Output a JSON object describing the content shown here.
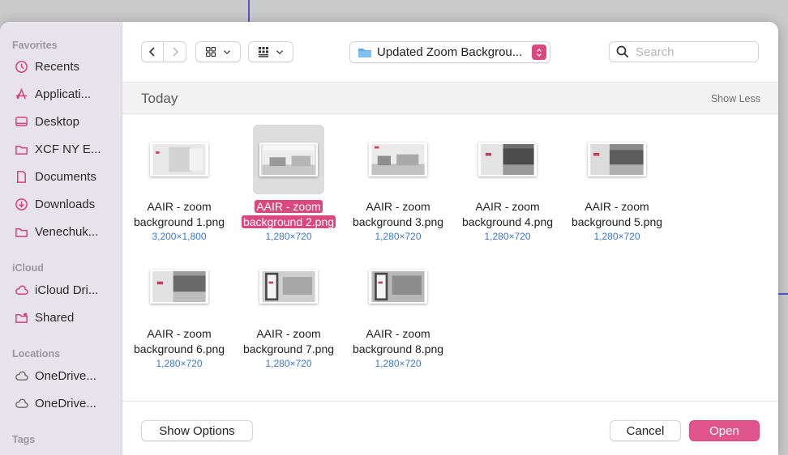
{
  "sidebar": {
    "sections": [
      {
        "label": "Favorites",
        "items": [
          {
            "label": "Recents",
            "icon": "clock-icon"
          },
          {
            "label": "Applicati...",
            "icon": "applications-icon"
          },
          {
            "label": "Desktop",
            "icon": "desktop-icon"
          },
          {
            "label": "XCF NY E...",
            "icon": "folder-icon"
          },
          {
            "label": "Documents",
            "icon": "document-icon"
          },
          {
            "label": "Downloads",
            "icon": "download-icon"
          },
          {
            "label": "Venechuk...",
            "icon": "folder-icon"
          }
        ]
      },
      {
        "label": "iCloud",
        "items": [
          {
            "label": "iCloud Dri...",
            "icon": "cloud-icon"
          },
          {
            "label": "Shared",
            "icon": "shared-folder-icon"
          }
        ]
      },
      {
        "label": "Locations",
        "items": [
          {
            "label": "OneDrive...",
            "icon": "cloud-icon"
          },
          {
            "label": "OneDrive...",
            "icon": "cloud-icon"
          }
        ]
      },
      {
        "label": "Tags",
        "items": []
      }
    ]
  },
  "toolbar": {
    "path_label": "Updated Zoom Backgrou...",
    "search_placeholder": "Search"
  },
  "group": {
    "title": "Today",
    "toggle_label": "Show Less"
  },
  "files": [
    {
      "name_line1": "AAIR - zoom",
      "name_line2": "background 1.png",
      "size": "3,200×1,800",
      "selected": false
    },
    {
      "name_line1": "AAIR - zoom",
      "name_line2": "background 2.png",
      "size": "1,280×720",
      "selected": true
    },
    {
      "name_line1": "AAIR - zoom",
      "name_line2": "background 3.png",
      "size": "1,280×720",
      "selected": false
    },
    {
      "name_line1": "AAIR - zoom",
      "name_line2": "background 4.png",
      "size": "1,280×720",
      "selected": false
    },
    {
      "name_line1": "AAIR - zoom",
      "name_line2": "background 5.png",
      "size": "1,280×720",
      "selected": false
    },
    {
      "name_line1": "AAIR - zoom",
      "name_line2": "background 6.png",
      "size": "1,280×720",
      "selected": false
    },
    {
      "name_line1": "AAIR - zoom",
      "name_line2": "background 7.png",
      "size": "1,280×720",
      "selected": false
    },
    {
      "name_line1": "AAIR - zoom",
      "name_line2": "background 8.png",
      "size": "1,280×720",
      "selected": false
    }
  ],
  "footer": {
    "options_label": "Show Options",
    "cancel_label": "Cancel",
    "open_label": "Open"
  },
  "colors": {
    "accent": "#d9487f",
    "size_text": "#3a77d0"
  }
}
